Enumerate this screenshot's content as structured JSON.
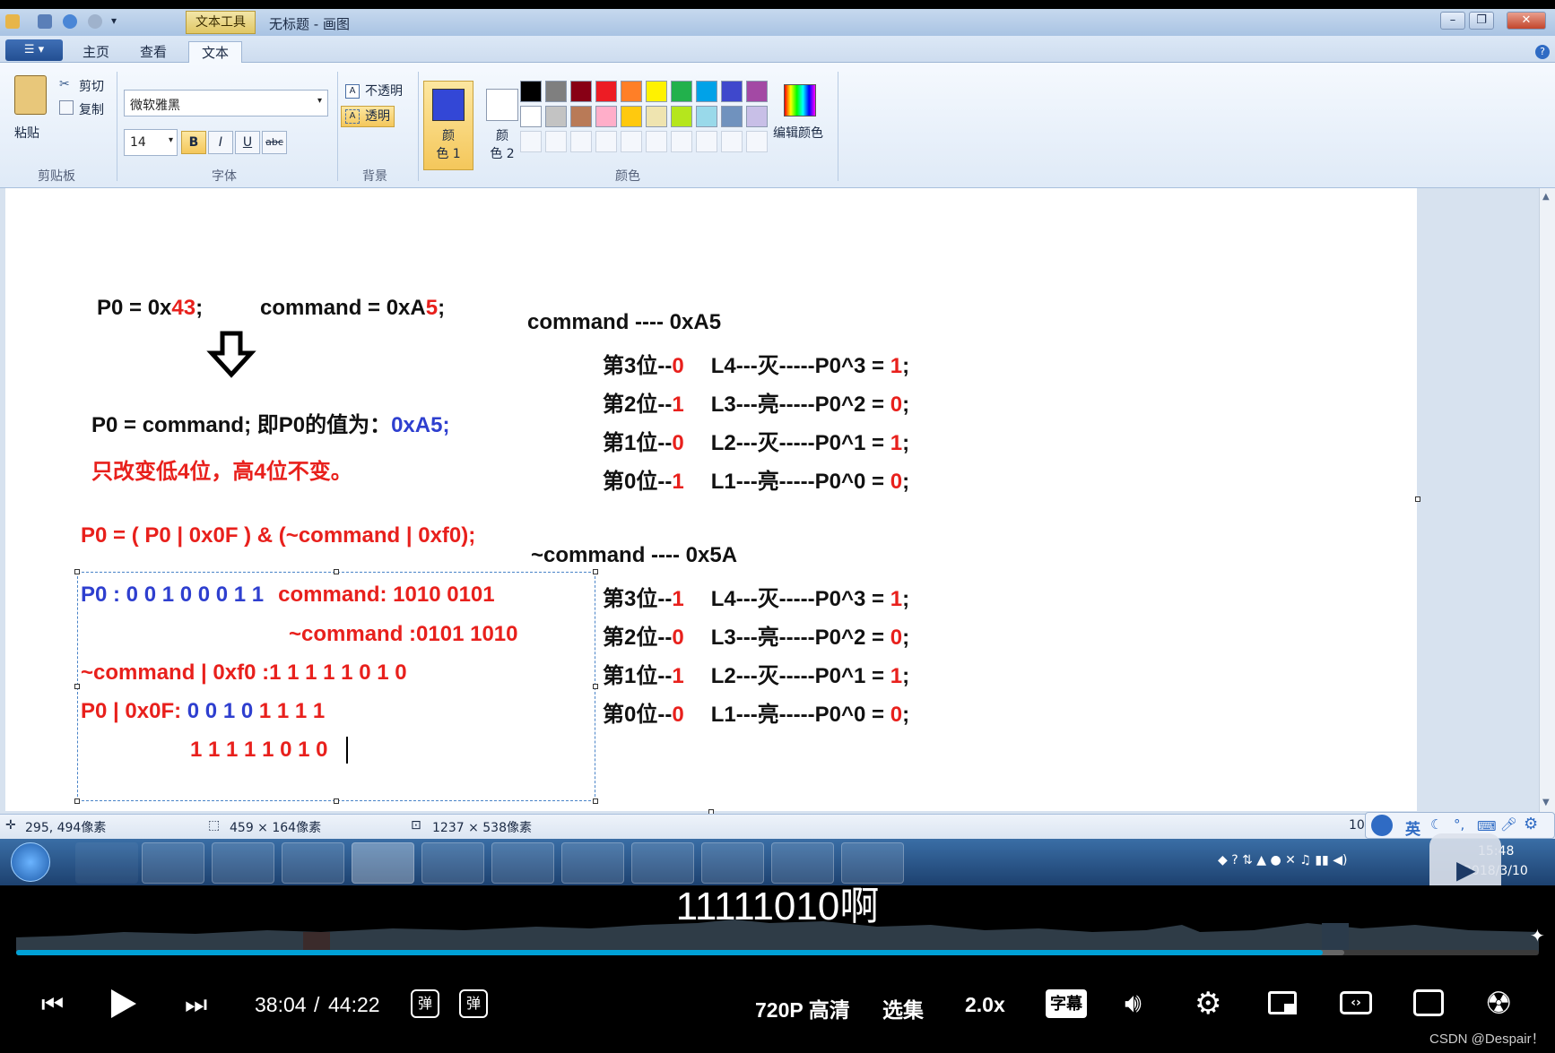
{
  "window": {
    "title": "无标题 - 画图",
    "context_tab": "文本工具"
  },
  "ribbon_tabs": [
    "主页",
    "查看",
    "文本"
  ],
  "clipboard": {
    "paste": "粘贴",
    "cut": "剪切",
    "copy": "复制",
    "group_label": "剪贴板"
  },
  "font": {
    "family": "微软雅黑",
    "size": "14",
    "bold": "B",
    "italic": "I",
    "underline": "U",
    "strike": "abc",
    "group_label": "字体"
  },
  "background": {
    "opaque": "不透明",
    "transparent": "透明",
    "group_label": "背景"
  },
  "colors": {
    "color1_label_a": "颜",
    "color1_label_b": "色 1",
    "color2_label_a": "颜",
    "color2_label_b": "色 2",
    "edit_colors": "编辑颜色",
    "group_label": "颜色",
    "color1": "#3347d6",
    "color2": "#ffffff",
    "palette_row1": [
      "#000000",
      "#7f7f7f",
      "#880015",
      "#ed1c24",
      "#ff7f27",
      "#fff200",
      "#22b14c",
      "#00a2e8",
      "#3f48cc",
      "#a349a4"
    ],
    "palette_row2": [
      "#ffffff",
      "#c3c3c3",
      "#b97a57",
      "#ffaec9",
      "#ffc90e",
      "#efe4b0",
      "#b5e61d",
      "#99d9ea",
      "#7092be",
      "#c8bfe7"
    ]
  },
  "canvas": {
    "line1_left": "P0 = 0x",
    "line1_left_red": "43",
    "line1_left_end": ";",
    "line1_right": "command = 0xA",
    "line1_right_red": "5",
    "line1_right_end": ";",
    "cmd_header": "command ---- 0xA5",
    "cmd_rows": [
      {
        "bit": "第3位--",
        "val": "0",
        "desc": "L4---灭-----P0^3 = ",
        "res": "1",
        "end": ";"
      },
      {
        "bit": "第2位--",
        "val": "1",
        "desc": "L3---亮-----P0^2 = ",
        "res": "0",
        "end": ";"
      },
      {
        "bit": "第1位--",
        "val": "0",
        "desc": "L2---灭-----P0^1 = ",
        "res": "1",
        "end": ";"
      },
      {
        "bit": "第0位--",
        "val": "1",
        "desc": "L1---亮-----P0^0 = ",
        "res": "0",
        "end": ";"
      }
    ],
    "assign_line": "P0 = command;  即P0的值为：",
    "assign_value": "0xA5;",
    "note_red": "只改变低4位，高4位不变。",
    "formula": "P0 =  ( P0 | 0x0F ) & (~command | 0xf0);",
    "ncmd_header": "~command ---- 0x5A",
    "ncmd_rows": [
      {
        "bit": "第3位--",
        "val": "1",
        "desc": "L4---灭-----P0^3 = ",
        "res": "1",
        "end": ";"
      },
      {
        "bit": "第2位--",
        "val": "0",
        "desc": "L3---亮-----P0^2 = ",
        "res": "0",
        "end": ";"
      },
      {
        "bit": "第1位--",
        "val": "1",
        "desc": "L2---灭-----P0^1 = ",
        "res": "1",
        "end": ";"
      },
      {
        "bit": "第0位--",
        "val": "0",
        "desc": "L1---亮-----P0^0 = ",
        "res": "0",
        "end": ";"
      }
    ],
    "box_line1_blue": "P0 : 0 0 1 0 0 0 1 1",
    "box_line1_red": "command: 1010 0101",
    "box_line2": "~command :0101 1010",
    "box_line3": "~command | 0xf0 :1 1 1 1 1 0 1 0",
    "box_line4_red": "P0 | 0x0F: ",
    "box_line4_blue": "0 0 1 0 ",
    "box_line4_red2": "1 1 1 1",
    "box_line5": "1 1 1 1 1 0 1 0"
  },
  "status": {
    "cursor": "295, 494像素",
    "selection": "459 × 164像素",
    "canvas_size": "1237 × 538像素",
    "zoom_partial": "10"
  },
  "ime": {
    "lang": "英"
  },
  "tray": {
    "time": "15:48",
    "date": "2018/3/10"
  },
  "player": {
    "subtitle": "11111010啊",
    "current_time": "38:04",
    "separator": "/",
    "total_time": "44:22",
    "quality": "720P 高清",
    "episodes": "选集",
    "speed": "2.0x",
    "captions": "字幕",
    "progress": 0.858,
    "buffered": 0.872,
    "watermark": "CSDN @Despair！"
  }
}
